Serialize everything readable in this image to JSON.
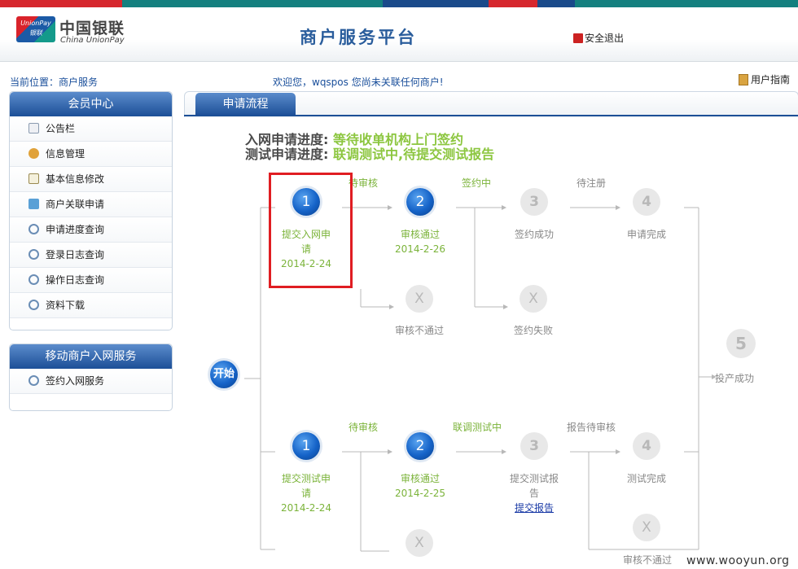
{
  "header": {
    "logo_badge": "UnionPay 银联",
    "logo_cn": "中国银联",
    "logo_en": "China UnionPay",
    "title": "商户服务平台",
    "logout_label": "安全退出"
  },
  "infobar": {
    "breadcrumb": "当前位置：商户服务",
    "welcome": "欢迎您，wqspos 您尚未关联任何商户!",
    "guide_label": "用户指南"
  },
  "sidebar": {
    "member": {
      "title": "会员中心",
      "items": [
        {
          "label": "公告栏",
          "icon": "notice-icon"
        },
        {
          "label": "信息管理",
          "icon": "users-icon"
        },
        {
          "label": "基本信息修改",
          "icon": "edit-icon"
        },
        {
          "label": "商户关联申请",
          "icon": "link-icon"
        },
        {
          "label": "申请进度查询",
          "icon": "search-icon"
        },
        {
          "label": "登录日志查询",
          "icon": "search-icon"
        },
        {
          "label": "操作日志查询",
          "icon": "search-icon"
        },
        {
          "label": "资料下载",
          "icon": "search-icon"
        }
      ]
    },
    "mobile": {
      "title": "移动商户入网服务",
      "items": [
        {
          "label": "签约入网服务",
          "icon": "search-icon"
        }
      ]
    }
  },
  "main": {
    "tab_label": "申请流程",
    "progress": {
      "network_label": "入网申请进度:",
      "network_value": "等待收单机构上门签约",
      "test_label": "测试申请进度:",
      "test_value": "联调测试中,待提交测试报告"
    },
    "flow": {
      "start_label": "开始",
      "final_number": "5",
      "final_label": "投产成功",
      "top": {
        "arrows": [
          "待审核",
          "签约中",
          "待注册"
        ],
        "steps": [
          {
            "number": "1",
            "label_line1": "提交入网申",
            "label_line2": "请",
            "date": "2014-2-24",
            "status": "done"
          },
          {
            "number": "2",
            "label_line1": "审核通过",
            "date": "2014-2-26",
            "status": "done"
          },
          {
            "number": "3",
            "label_line1": "签约成功",
            "status": "todo"
          },
          {
            "number": "4",
            "label_line1": "申请完成",
            "status": "todo"
          }
        ],
        "fails": [
          {
            "symbol": "X",
            "label": "审核不通过"
          },
          {
            "symbol": "X",
            "label": "签约失败"
          }
        ]
      },
      "bottom": {
        "arrows": [
          "待审核",
          "联调测试中",
          "报告待审核"
        ],
        "steps": [
          {
            "number": "1",
            "label_line1": "提交测试申",
            "label_line2": "请",
            "date": "2014-2-24",
            "status": "done"
          },
          {
            "number": "2",
            "label_line1": "审核通过",
            "date": "2014-2-25",
            "status": "done"
          },
          {
            "number": "3",
            "label_line1": "提交测试报",
            "label_line2": "告",
            "link": "提交报告",
            "status": "todo"
          },
          {
            "number": "4",
            "label_line1": "测试完成",
            "status": "todo"
          }
        ],
        "fails": [
          {
            "symbol": "X"
          },
          {
            "symbol": "X",
            "label": "审核不通过"
          }
        ]
      }
    }
  },
  "watermark": "www.wooyun.org",
  "colors": {
    "stripe_red": "#d6272e",
    "stripe_blue": "#1a4a8a",
    "stripe_teal": "#14807f",
    "accent_blue": "#1c4f97",
    "done_green": "#7bb33a",
    "highlight_red": "#e01d22"
  }
}
